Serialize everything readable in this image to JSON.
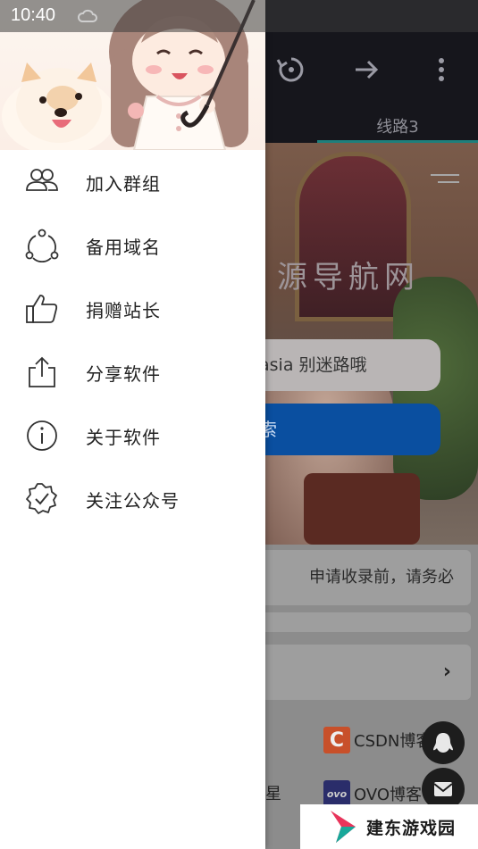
{
  "status_bar": {
    "time": "10:40"
  },
  "background_app": {
    "route_tab": "线路3",
    "site_title": "源导航网",
    "search_input_text": "asia 别迷路哦",
    "search_button_text": "索",
    "notice_text": "申请收录前，请务必",
    "links": [
      {
        "name": "CSDN博客",
        "logo_text": "C"
      },
      {
        "name": "OVO博客",
        "logo_text": "ovo"
      }
    ],
    "side_fragment": "星",
    "watermark": "建东游戏园"
  },
  "drawer": {
    "menu": [
      {
        "label": "加入群组",
        "icon": "group-icon"
      },
      {
        "label": "备用域名",
        "icon": "share-nodes-icon"
      },
      {
        "label": "捐赠站长",
        "icon": "thumbs-up-icon"
      },
      {
        "label": "分享软件",
        "icon": "share-upload-icon"
      },
      {
        "label": "关于软件",
        "icon": "info-icon"
      },
      {
        "label": "关注公众号",
        "icon": "verified-badge-icon"
      }
    ]
  }
}
